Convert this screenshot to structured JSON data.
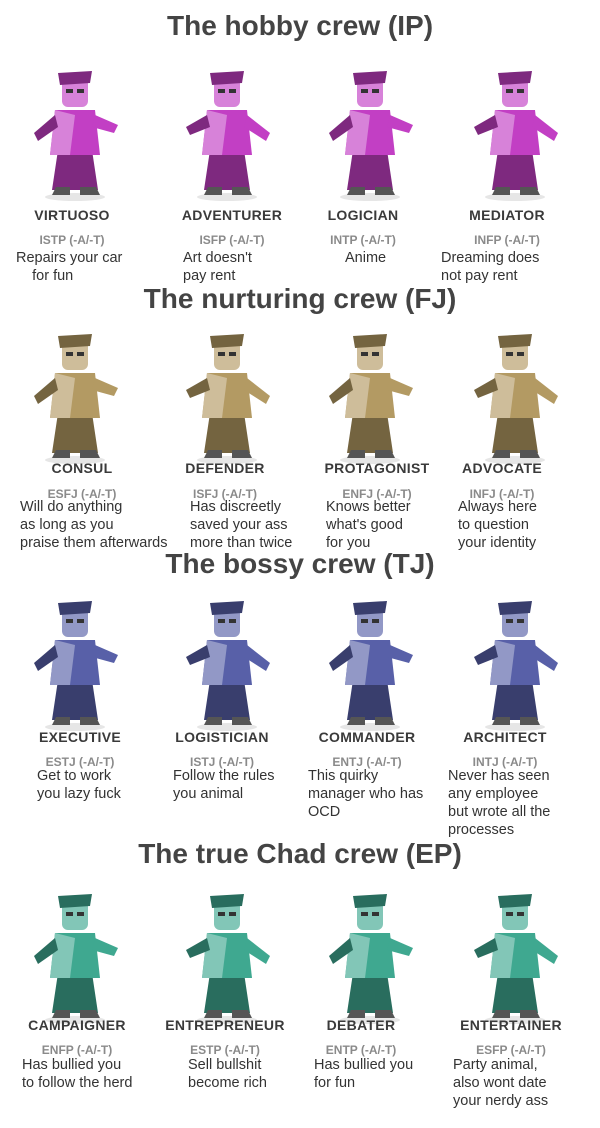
{
  "sections": [
    {
      "title": "The hobby crew (IP)",
      "color": "#c23fc4",
      "types": [
        {
          "name": "VIRTUOSO",
          "code": "ISTP (-A/-T)",
          "joke": "Repairs your car\n    for fun"
        },
        {
          "name": "ADVENTURER",
          "code": "ISFP (-A/-T)",
          "joke": "Art doesn't\npay rent"
        },
        {
          "name": "LOGICIAN",
          "code": "INTP (-A/-T)",
          "joke": "Anime"
        },
        {
          "name": "MEDIATOR",
          "code": "INFP (-A/-T)",
          "joke": "Dreaming does\nnot pay rent"
        }
      ]
    },
    {
      "title": "The nurturing crew (FJ)",
      "color": "#b39a63",
      "types": [
        {
          "name": "CONSUL",
          "code": "ESFJ (-A/-T)",
          "joke": "Will do anything\nas long as you\npraise them afterwards"
        },
        {
          "name": "DEFENDER",
          "code": "ISFJ (-A/-T)",
          "joke": "Has discreetly\nsaved your ass\nmore than twice"
        },
        {
          "name": "PROTAGONIST",
          "code": "ENFJ (-A/-T)",
          "joke": "Knows better\nwhat's good\nfor you"
        },
        {
          "name": "ADVOCATE",
          "code": "INFJ (-A/-T)",
          "joke": "Always here\nto question\nyour identity"
        }
      ]
    },
    {
      "title": "The bossy crew (TJ)",
      "color": "#5860a8",
      "types": [
        {
          "name": "EXECUTIVE",
          "code": "ESTJ (-A/-T)",
          "joke": "Get to work\nyou lazy fuck"
        },
        {
          "name": "LOGISTICIAN",
          "code": "ISTJ (-A/-T)",
          "joke": "Follow the rules\nyou animal"
        },
        {
          "name": "COMMANDER",
          "code": "ENTJ (-A/-T)",
          "joke": "This quirky\nmanager who has\nOCD"
        },
        {
          "name": "ARCHITECT",
          "code": "INTJ (-A/-T)",
          "joke": "Never has seen\nany employee\nbut wrote all the\nprocesses"
        }
      ]
    },
    {
      "title": "The true Chad crew (EP)",
      "color": "#3fa890",
      "types": [
        {
          "name": "CAMPAIGNER",
          "code": "ENFP (-A/-T)",
          "joke": "Has bullied you\nto follow the herd"
        },
        {
          "name": "ENTREPRENEUR",
          "code": "ESTP (-A/-T)",
          "joke": "Sell bullshit\nbecome rich"
        },
        {
          "name": "DEBATER",
          "code": "ENTP (-A/-T)",
          "joke": "Has bullied you\nfor fun"
        },
        {
          "name": "ENTERTAINER",
          "code": "ESFP (-A/-T)",
          "joke": "Party animal,\nalso wont date\nyour nerdy ass"
        }
      ]
    }
  ]
}
